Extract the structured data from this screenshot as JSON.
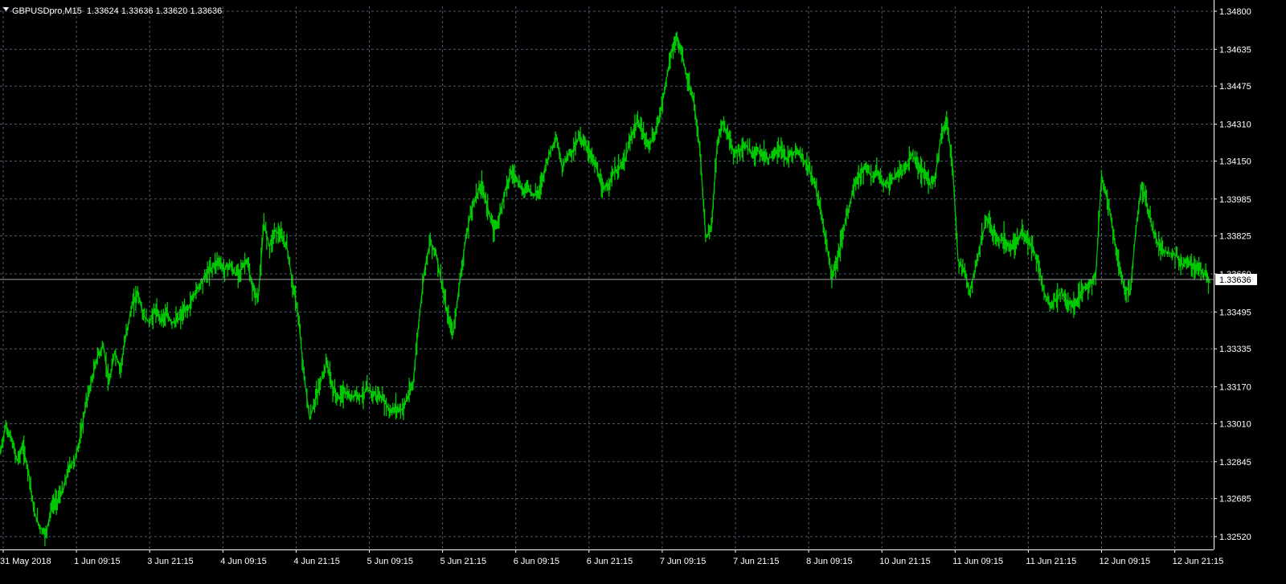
{
  "header": {
    "symbol_label": "GBPUSDpro,M15",
    "ohlc_values": "1.33624 1.33636 1.33620 1.33636",
    "menu_icon": "triangle-down-icon"
  },
  "current_price": "1.33636",
  "colors": {
    "background": "#000000",
    "grid": "#4a5a6b",
    "series": "#00c800",
    "axis": "#ffffff",
    "price_line": "#9e9e9e",
    "price_box": "#ffffff"
  },
  "chart_data": {
    "type": "line",
    "grid": true,
    "ylim": [
      1.3244,
      1.3481
    ],
    "y_ticks": [
      "1.34800",
      "1.34635",
      "1.34475",
      "1.34310",
      "1.34150",
      "1.33985",
      "1.33825",
      "1.33660",
      "1.33495",
      "1.33335",
      "1.33170",
      "1.33010",
      "1.32845",
      "1.32685",
      "1.32520"
    ],
    "x_ticks": [
      "31 May 2018",
      "1 Jun 09:15",
      "3 Jun 21:15",
      "4 Jun 09:15",
      "4 Jun 21:15",
      "5 Jun 09:15",
      "5 Jun 21:15",
      "6 Jun 09:15",
      "6 Jun 21:15",
      "7 Jun 09:15",
      "7 Jun 21:15",
      "8 Jun 09:15",
      "10 Jun 21:15",
      "11 Jun 09:15",
      "11 Jun 21:15",
      "12 Jun 09:15",
      "12 Jun 21:15"
    ],
    "series": [
      {
        "values": [
          1.3288,
          1.33,
          1.3294,
          1.3285,
          1.3291,
          1.328,
          1.3262,
          1.3256,
          1.3253,
          1.3265,
          1.3268,
          1.3272,
          1.3282,
          1.3285,
          1.3295,
          1.331,
          1.332,
          1.333,
          1.3335,
          1.3318,
          1.3332,
          1.3325,
          1.334,
          1.3352,
          1.3358,
          1.3348,
          1.3345,
          1.335,
          1.3347,
          1.3348,
          1.3345,
          1.3346,
          1.3349,
          1.3352,
          1.3358,
          1.3362,
          1.3366,
          1.3369,
          1.3372,
          1.3368,
          1.337,
          1.3366,
          1.3368,
          1.3372,
          1.336,
          1.3355,
          1.3388,
          1.3378,
          1.3385,
          1.3382,
          1.3378,
          1.3362,
          1.3348,
          1.3322,
          1.3303,
          1.3312,
          1.332,
          1.3328,
          1.3316,
          1.3312,
          1.3315,
          1.3312,
          1.3314,
          1.3313,
          1.3316,
          1.3314,
          1.3313,
          1.3311,
          1.3306,
          1.3308,
          1.3307,
          1.3312,
          1.3318,
          1.3345,
          1.3368,
          1.338,
          1.3375,
          1.3362,
          1.3348,
          1.334,
          1.336,
          1.3378,
          1.3392,
          1.34,
          1.3405,
          1.3395,
          1.3385,
          1.339,
          1.3402,
          1.341,
          1.3408,
          1.3402,
          1.3404,
          1.34,
          1.3402,
          1.3412,
          1.342,
          1.3425,
          1.3412,
          1.3418,
          1.342,
          1.3426,
          1.3422,
          1.3418,
          1.3412,
          1.3402,
          1.3405,
          1.341,
          1.3412,
          1.3416,
          1.3425,
          1.3432,
          1.3428,
          1.3422,
          1.3425,
          1.3435,
          1.3448,
          1.3462,
          1.3468,
          1.346,
          1.3448,
          1.344,
          1.342,
          1.3382,
          1.3385,
          1.3422,
          1.3432,
          1.3425,
          1.3418,
          1.342,
          1.3422,
          1.3418,
          1.342,
          1.3418,
          1.3416,
          1.3418,
          1.342,
          1.3416,
          1.3418,
          1.342,
          1.3416,
          1.3412,
          1.3405,
          1.3395,
          1.338,
          1.3365,
          1.3372,
          1.3385,
          1.3395,
          1.3405,
          1.341,
          1.3412,
          1.3408,
          1.341,
          1.3405,
          1.3406,
          1.3408,
          1.341,
          1.3412,
          1.3418,
          1.3412,
          1.341,
          1.3405,
          1.3408,
          1.3425,
          1.3432,
          1.3415,
          1.3372,
          1.3368,
          1.3358,
          1.3368,
          1.338,
          1.339,
          1.3385,
          1.338,
          1.3382,
          1.3378,
          1.338,
          1.3383,
          1.3381,
          1.3378,
          1.337,
          1.3358,
          1.3352,
          1.3355,
          1.3358,
          1.3354,
          1.3352,
          1.3356,
          1.336,
          1.3362,
          1.3365,
          1.3408,
          1.34,
          1.3385,
          1.337,
          1.336,
          1.3358,
          1.3385,
          1.3405,
          1.3395,
          1.3385,
          1.3378,
          1.3376,
          1.3375,
          1.3374,
          1.337,
          1.3372,
          1.337,
          1.3368,
          1.3366,
          1.3362
        ]
      }
    ]
  }
}
